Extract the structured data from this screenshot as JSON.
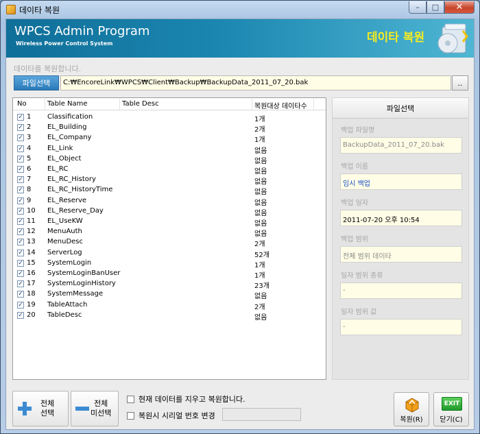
{
  "window": {
    "title": "데이타 복원",
    "controls": {
      "minimize": "–",
      "maximize": "□",
      "close": "✕"
    }
  },
  "banner": {
    "title": "WPCS Admin Program",
    "subtitle": "Wireless Power Control System",
    "page_heading": "데이타 복원"
  },
  "hint": "데이타를 복원합니다.",
  "file_select": {
    "button_label": "파일선택",
    "path": "C:₩EncoreLink₩WPCS₩Client₩Backup₩BackupData_2011_07_20.bak",
    "browse_label": ".."
  },
  "table": {
    "columns": [
      "No",
      "Table Name",
      "Table Desc",
      "복원대상 데이타수"
    ],
    "rows": [
      {
        "no": "1",
        "name": "Classification",
        "desc": "",
        "count": "1개",
        "checked": true
      },
      {
        "no": "2",
        "name": "EL_Building",
        "desc": "",
        "count": "2개",
        "checked": true
      },
      {
        "no": "3",
        "name": "EL_Company",
        "desc": "",
        "count": "1개",
        "checked": true
      },
      {
        "no": "4",
        "name": "EL_Link",
        "desc": "",
        "count": "없음",
        "checked": true
      },
      {
        "no": "5",
        "name": "EL_Object",
        "desc": "",
        "count": "없음",
        "checked": true
      },
      {
        "no": "6",
        "name": "EL_RC",
        "desc": "",
        "count": "없음",
        "checked": true
      },
      {
        "no": "7",
        "name": "EL_RC_History",
        "desc": "",
        "count": "없음",
        "checked": true
      },
      {
        "no": "8",
        "name": "EL_RC_HistoryTime",
        "desc": "",
        "count": "없음",
        "checked": true
      },
      {
        "no": "9",
        "name": "EL_Reserve",
        "desc": "",
        "count": "없음",
        "checked": true
      },
      {
        "no": "10",
        "name": "EL_Reserve_Day",
        "desc": "",
        "count": "없음",
        "checked": true
      },
      {
        "no": "11",
        "name": "EL_UseKW",
        "desc": "",
        "count": "없음",
        "checked": true
      },
      {
        "no": "12",
        "name": "MenuAuth",
        "desc": "",
        "count": "없음",
        "checked": true
      },
      {
        "no": "13",
        "name": "MenuDesc",
        "desc": "",
        "count": "2개",
        "checked": true
      },
      {
        "no": "14",
        "name": "ServerLog",
        "desc": "",
        "count": "52개",
        "checked": true
      },
      {
        "no": "15",
        "name": "SystemLogin",
        "desc": "",
        "count": "1개",
        "checked": true
      },
      {
        "no": "16",
        "name": "SystemLoginBanUser",
        "desc": "",
        "count": "1개",
        "checked": true
      },
      {
        "no": "17",
        "name": "SystemLoginHistory",
        "desc": "",
        "count": "23개",
        "checked": true
      },
      {
        "no": "18",
        "name": "SystemMessage",
        "desc": "",
        "count": "없음",
        "checked": true
      },
      {
        "no": "19",
        "name": "TableAttach",
        "desc": "",
        "count": "2개",
        "checked": true
      },
      {
        "no": "20",
        "name": "TableDesc",
        "desc": "",
        "count": "없음",
        "checked": true
      }
    ]
  },
  "info": {
    "header": "파일선택",
    "fields": [
      {
        "label": "백업 파일명",
        "value": "BackupData_2011_07_20.bak",
        "color": "#8a8a8a"
      },
      {
        "label": "백업 이름",
        "value": "임시 백업",
        "color": "#1a52c9"
      },
      {
        "label": "백업 일자",
        "value": "2011-07-20 오후 10:54",
        "color": "#000000"
      },
      {
        "label": "백업 범위",
        "value": "전체 범위 데이타",
        "color": "#8a8a8a"
      },
      {
        "label": "일자 범위 종류",
        "value": "-",
        "color": "#8a8a8a"
      },
      {
        "label": "일자 범위 값",
        "value": "-",
        "color": "#8a8a8a"
      }
    ]
  },
  "bottom": {
    "select_all": {
      "line1": "전체",
      "line2": "선택"
    },
    "deselect_all": {
      "line1": "전체",
      "line2": "미선택"
    },
    "option_clear": "현재 데이터를 지우고 복원합니다.",
    "option_serial": "복원시 시리얼 번호 변경",
    "restore_label": "복원(R)",
    "close_label": "닫기(C)",
    "exit_icon_text": "EXIT"
  },
  "colors": {
    "banner_start": "#0f6f99",
    "banner_end": "#4fb6d3",
    "banner_heading": "#f7ec1e",
    "file_button": "#2a79b8",
    "input_bg": "#fffde6"
  }
}
